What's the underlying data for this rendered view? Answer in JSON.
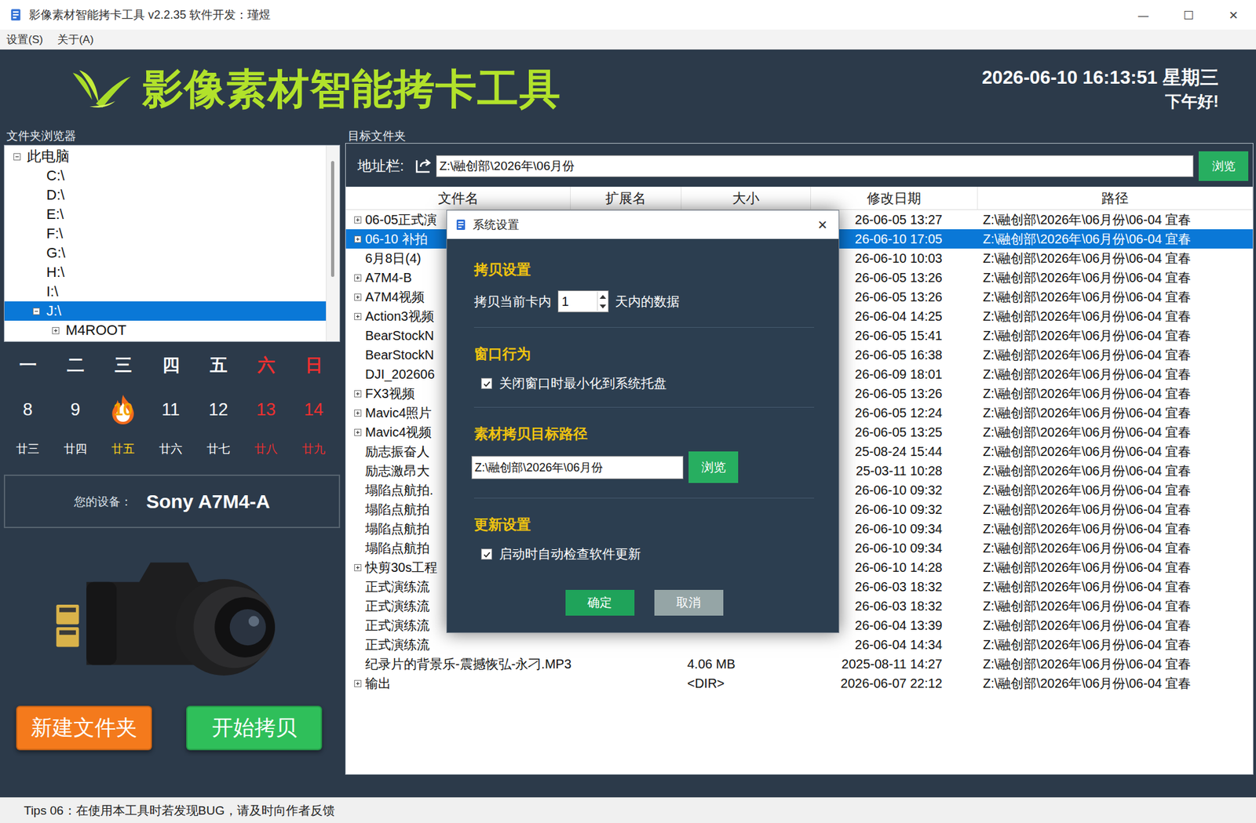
{
  "window": {
    "title": "影像素材智能拷卡工具 v2.2.35  软件开发：瑾煜",
    "controls": [
      "—",
      "☐",
      "✕"
    ]
  },
  "menu": [
    "设置(S)",
    "关于(A)"
  ],
  "header": {
    "title": "影像素材智能拷卡工具",
    "datetime": "2026-06-10 16:13:51 星期三",
    "greeting": "下午好!"
  },
  "folder_browser": {
    "label": "文件夹浏览器",
    "items": [
      {
        "label": "此电脑",
        "depth": 0,
        "expandable": true,
        "expanded": true,
        "selected": false
      },
      {
        "label": "C:\\",
        "depth": 1,
        "expandable": false,
        "expanded": false,
        "selected": false
      },
      {
        "label": "D:\\",
        "depth": 1,
        "expandable": false,
        "expanded": false,
        "selected": false
      },
      {
        "label": "E:\\",
        "depth": 1,
        "expandable": false,
        "expanded": false,
        "selected": false
      },
      {
        "label": "F:\\",
        "depth": 1,
        "expandable": false,
        "expanded": false,
        "selected": false
      },
      {
        "label": "G:\\",
        "depth": 1,
        "expandable": false,
        "expanded": false,
        "selected": false
      },
      {
        "label": "H:\\",
        "depth": 1,
        "expandable": false,
        "expanded": false,
        "selected": false
      },
      {
        "label": "I:\\",
        "depth": 1,
        "expandable": false,
        "expanded": false,
        "selected": false
      },
      {
        "label": "J:\\",
        "depth": 1,
        "expandable": true,
        "expanded": true,
        "selected": true
      },
      {
        "label": "M4ROOT",
        "depth": 2,
        "expandable": true,
        "expanded": false,
        "selected": false
      }
    ]
  },
  "calendar": {
    "weekdays": [
      {
        "label": "一",
        "weekend": false
      },
      {
        "label": "二",
        "weekend": false
      },
      {
        "label": "三",
        "weekend": false
      },
      {
        "label": "四",
        "weekend": false
      },
      {
        "label": "五",
        "weekend": false
      },
      {
        "label": "六",
        "weekend": true
      },
      {
        "label": "日",
        "weekend": true
      }
    ],
    "days": [
      {
        "day": "8",
        "lunar": "廿三",
        "weekend": false,
        "today": false
      },
      {
        "day": "9",
        "lunar": "廿四",
        "weekend": false,
        "today": false
      },
      {
        "day": "10",
        "lunar": "廿五",
        "weekend": false,
        "today": true
      },
      {
        "day": "11",
        "lunar": "廿六",
        "weekend": false,
        "today": false
      },
      {
        "day": "12",
        "lunar": "廿七",
        "weekend": false,
        "today": false
      },
      {
        "day": "13",
        "lunar": "廿八",
        "weekend": true,
        "today": false
      },
      {
        "day": "14",
        "lunar": "廿九",
        "weekend": true,
        "today": false
      }
    ]
  },
  "device": {
    "label": "您的设备：",
    "name": "Sony A7M4-A"
  },
  "buttons": [
    {
      "label": "新建文件夹",
      "color": "#f47a1c"
    },
    {
      "label": "开始拷贝",
      "color": "#2fbf5a"
    }
  ],
  "target": {
    "label": "目标文件夹",
    "address_label": "地址栏:",
    "address": "Z:\\融创部\\2026年\\06月份",
    "browse": "浏览"
  },
  "table": {
    "columns": [
      "文件名",
      "扩展名",
      "大小",
      "修改日期",
      "路径"
    ],
    "rows": [
      {
        "name": "06-05正式演",
        "ext": "",
        "size": "",
        "date": "26-06-05 13:27",
        "path": "Z:\\融创部\\2026年\\06月份\\06-04 宜春",
        "expandable": true,
        "selected": false
      },
      {
        "name": "06-10 补拍",
        "ext": "",
        "size": "",
        "date": "26-06-10 17:05",
        "path": "Z:\\融创部\\2026年\\06月份\\06-04 宜春",
        "expandable": true,
        "selected": true
      },
      {
        "name": "6月8日(4)",
        "ext": "",
        "size": "",
        "date": "26-06-10 10:03",
        "path": "Z:\\融创部\\2026年\\06月份\\06-04 宜春",
        "expandable": false,
        "selected": false
      },
      {
        "name": "A7M4-B",
        "ext": "",
        "size": "",
        "date": "26-06-05 13:26",
        "path": "Z:\\融创部\\2026年\\06月份\\06-04 宜春",
        "expandable": true,
        "selected": false
      },
      {
        "name": "A7M4视频",
        "ext": "",
        "size": "",
        "date": "26-06-05 13:26",
        "path": "Z:\\融创部\\2026年\\06月份\\06-04 宜春",
        "expandable": true,
        "selected": false
      },
      {
        "name": "Action3视频",
        "ext": "",
        "size": "",
        "date": "26-06-04 14:25",
        "path": "Z:\\融创部\\2026年\\06月份\\06-04 宜春",
        "expandable": true,
        "selected": false
      },
      {
        "name": "BearStockN",
        "ext": "",
        "size": "",
        "date": "26-06-05 15:41",
        "path": "Z:\\融创部\\2026年\\06月份\\06-04 宜春",
        "expandable": false,
        "selected": false
      },
      {
        "name": "BearStockN",
        "ext": "",
        "size": "",
        "date": "26-06-05 16:38",
        "path": "Z:\\融创部\\2026年\\06月份\\06-04 宜春",
        "expandable": false,
        "selected": false
      },
      {
        "name": "DJI_202606",
        "ext": "",
        "size": "",
        "date": "26-06-09 18:01",
        "path": "Z:\\融创部\\2026年\\06月份\\06-04 宜春",
        "expandable": false,
        "selected": false
      },
      {
        "name": "FX3视频",
        "ext": "",
        "size": "",
        "date": "26-06-05 13:26",
        "path": "Z:\\融创部\\2026年\\06月份\\06-04 宜春",
        "expandable": true,
        "selected": false
      },
      {
        "name": "Mavic4照片",
        "ext": "",
        "size": "",
        "date": "26-06-05 12:24",
        "path": "Z:\\融创部\\2026年\\06月份\\06-04 宜春",
        "expandable": true,
        "selected": false
      },
      {
        "name": "Mavic4视频",
        "ext": "",
        "size": "",
        "date": "26-06-05 13:25",
        "path": "Z:\\融创部\\2026年\\06月份\\06-04 宜春",
        "expandable": true,
        "selected": false
      },
      {
        "name": "励志振奋人",
        "ext": "",
        "size": "",
        "date": "25-08-24 15:44",
        "path": "Z:\\融创部\\2026年\\06月份\\06-04 宜春",
        "expandable": false,
        "selected": false
      },
      {
        "name": "励志激昂大",
        "ext": "",
        "size": "",
        "date": "25-03-11 10:28",
        "path": "Z:\\融创部\\2026年\\06月份\\06-04 宜春",
        "expandable": false,
        "selected": false
      },
      {
        "name": "塌陷点航拍.",
        "ext": "",
        "size": "",
        "date": "26-06-10 09:32",
        "path": "Z:\\融创部\\2026年\\06月份\\06-04 宜春",
        "expandable": false,
        "selected": false
      },
      {
        "name": "塌陷点航拍",
        "ext": "",
        "size": "",
        "date": "26-06-10 09:32",
        "path": "Z:\\融创部\\2026年\\06月份\\06-04 宜春",
        "expandable": false,
        "selected": false
      },
      {
        "name": "塌陷点航拍",
        "ext": "",
        "size": "",
        "date": "26-06-10 09:34",
        "path": "Z:\\融创部\\2026年\\06月份\\06-04 宜春",
        "expandable": false,
        "selected": false
      },
      {
        "name": "塌陷点航拍",
        "ext": "",
        "size": "",
        "date": "26-06-10 09:34",
        "path": "Z:\\融创部\\2026年\\06月份\\06-04 宜春",
        "expandable": false,
        "selected": false
      },
      {
        "name": "快剪30s工程",
        "ext": "",
        "size": "",
        "date": "26-06-10 14:28",
        "path": "Z:\\融创部\\2026年\\06月份\\06-04 宜春",
        "expandable": true,
        "selected": false
      },
      {
        "name": "正式演练流",
        "ext": "",
        "size": "",
        "date": "26-06-03 18:32",
        "path": "Z:\\融创部\\2026年\\06月份\\06-04 宜春",
        "expandable": false,
        "selected": false
      },
      {
        "name": "正式演练流",
        "ext": "",
        "size": "",
        "date": "26-06-03 18:32",
        "path": "Z:\\融创部\\2026年\\06月份\\06-04 宜春",
        "expandable": false,
        "selected": false
      },
      {
        "name": "正式演练流",
        "ext": "",
        "size": "",
        "date": "26-06-04 13:39",
        "path": "Z:\\融创部\\2026年\\06月份\\06-04 宜春",
        "expandable": false,
        "selected": false
      },
      {
        "name": "正式演练流",
        "ext": "",
        "size": "",
        "date": "26-06-04 14:34",
        "path": "Z:\\融创部\\2026年\\06月份\\06-04 宜春",
        "expandable": false,
        "selected": false
      },
      {
        "name": "纪录片的背景乐-震撼恢弘-永刁.MP3",
        "ext": "",
        "size": "4.06 MB",
        "date": "2025-08-11 14:27",
        "path": "Z:\\融创部\\2026年\\06月份\\06-04 宜春",
        "expandable": false,
        "selected": false
      },
      {
        "name": "输出",
        "ext": "",
        "size": "<DIR>",
        "date": "2026-06-07 22:12",
        "path": "Z:\\融创部\\2026年\\06月份\\06-04 宜春",
        "expandable": true,
        "selected": false
      }
    ]
  },
  "dialog": {
    "title": "系统设置",
    "close": "✕",
    "sections": [
      {
        "title": "拷贝设置",
        "kind": "spin",
        "before": "拷贝当前卡内",
        "value": "1",
        "after": "天内的数据"
      },
      {
        "title": "窗口行为",
        "kind": "checkbox",
        "label": "关闭窗口时最小化到系统托盘",
        "checked": true
      },
      {
        "title": "素材拷贝目标路径",
        "kind": "path",
        "value": "Z:\\融创部\\2026年\\06月份",
        "button": "浏览"
      },
      {
        "title": "更新设置",
        "kind": "checkbox",
        "label": "启动时自动检查软件更新",
        "checked": true
      }
    ],
    "buttons": [
      {
        "label": "确定",
        "kind": "primary"
      },
      {
        "label": "取消",
        "kind": "secondary"
      }
    ]
  },
  "status_bar": "Tips 06：在使用本工具时若发现BUG，请及时向作者反馈"
}
